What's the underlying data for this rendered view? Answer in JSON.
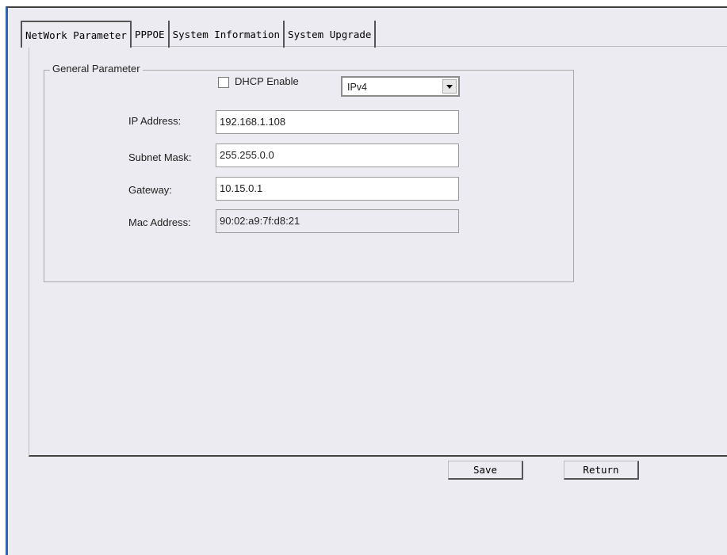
{
  "tabs": [
    {
      "label": "NetWork Parameter",
      "active": true
    },
    {
      "label": "PPPOE",
      "active": false
    },
    {
      "label": "System Information",
      "active": false
    },
    {
      "label": "System Upgrade",
      "active": false
    }
  ],
  "general": {
    "legend": "General Parameter",
    "dhcp": {
      "label": "DHCP Enable",
      "checked": false
    },
    "ip_version": {
      "selected": "IPv4"
    },
    "fields": {
      "ip_address": {
        "label": "IP Address:",
        "value": "192.168.1.108"
      },
      "subnet_mask": {
        "label": "Subnet Mask:",
        "value": "255.255.0.0"
      },
      "gateway": {
        "label": "Gateway:",
        "value": "10.15.0.1"
      },
      "mac_address": {
        "label": "Mac Address:",
        "value": "90:02:a9:7f:d8:21"
      }
    }
  },
  "buttons": {
    "save_label": "Save",
    "return_label": "Return"
  },
  "icons": {
    "dropdown": "chevron-down-icon"
  }
}
